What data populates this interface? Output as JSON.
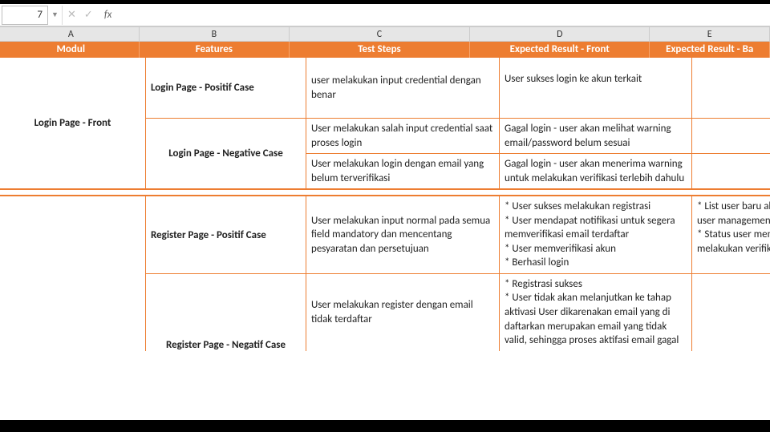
{
  "formula_bar": {
    "cell_ref": "7",
    "fx": "fx",
    "value": ""
  },
  "columns": {
    "A": "A",
    "B": "B",
    "C": "C",
    "D": "D",
    "E": "E"
  },
  "headers": {
    "A": "Modul",
    "B": "Features",
    "C": "Test Steps",
    "D": "Expected Result - Front",
    "E": "Expected Result - Ba"
  },
  "rows": {
    "login": {
      "modul": "Login Page - Front",
      "positive": {
        "feature": "Login Page - Positif Case",
        "step": "user melakukan input credential dengan benar",
        "exp_front": "User sukses login ke akun terkait",
        "exp_back": ""
      },
      "negative": {
        "feature": "Login Page - Negative Case",
        "r1": {
          "step": "User melakukan salah input credential saat proses login",
          "exp_front": "Gagal login - user akan melihat warning email/password belum sesuai",
          "exp_back": ""
        },
        "r2": {
          "step": "User melakukan login dengan email yang belum terverifikasi",
          "exp_front": "Gagal login - user akan menerima warning untuk melakukan verifikasi terlebih dahulu",
          "exp_back": ""
        }
      }
    },
    "register": {
      "modul": "",
      "positive": {
        "feature": "Register Page - Positif Case",
        "step": "User melakukan input normal pada semua field mandatory dan mencentang pesyaratan dan persetujuan",
        "exp_front": "* User sukses melakukan registrasi\n* User mendapat notifikasi untuk segera memverifikasi email terdaftar\n* User memverifikasi akun\n* Berhasil login",
        "exp_back": "* List user baru akan m\nuser management > u\n* Status user menjadi\nmelakukan verifikasi"
      },
      "negative": {
        "feature": "Register Page - Negatif Case",
        "r1": {
          "step": "User melakukan register dengan email tidak terdaftar",
          "exp_front": "* Registrasi sukses\n* User tidak akan melanjutkan ke tahap aktivasi User dikarenakan email yang di daftarkan merupakan email yang tidak valid, sehingga proses aktifasi email gagal",
          "exp_back": ""
        }
      }
    }
  }
}
